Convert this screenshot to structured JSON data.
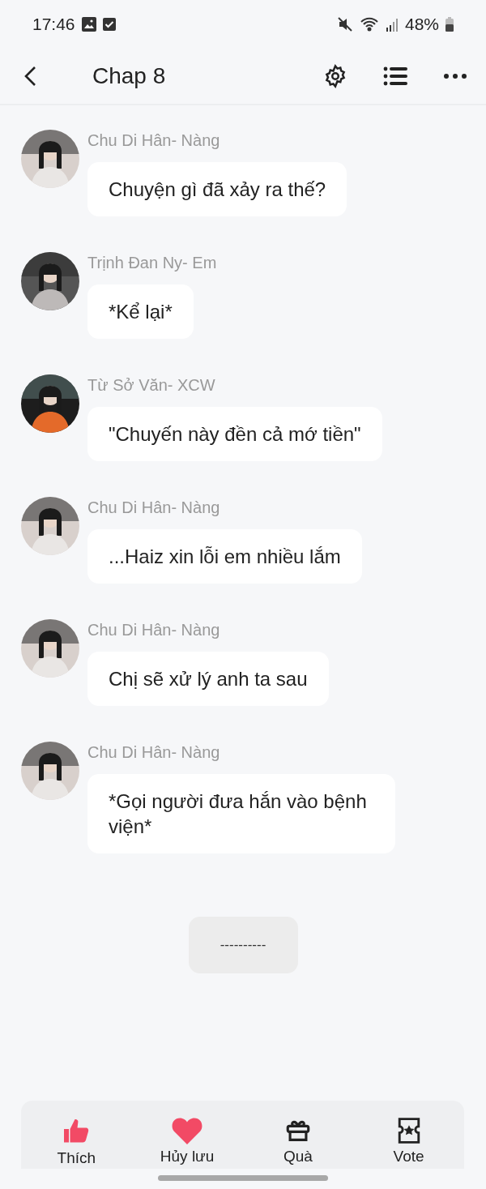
{
  "status_bar": {
    "time": "17:46",
    "battery": "48%"
  },
  "header": {
    "title": "Chap 8"
  },
  "messages": [
    {
      "name": "Chu Di Hân- Nàng",
      "text": "Chuyện gì đã xảy ra thế?"
    },
    {
      "name": "Trịnh Đan Ny- Em",
      "text": "*Kể lại*"
    },
    {
      "name": "Từ Sở Văn- XCW",
      "text": "\"Chuyến này đền cả mớ tiền\""
    },
    {
      "name": "Chu Di Hân- Nàng",
      "text": "...Haiz xin lỗi em nhiều lắm"
    },
    {
      "name": "Chu Di Hân- Nàng",
      "text": "Chị sẽ xử lý anh ta sau"
    },
    {
      "name": "Chu Di Hân- Nàng",
      "text": "*Gọi người đưa hắn vào bệnh viện*"
    }
  ],
  "divider": "----------",
  "actions": [
    {
      "kind": "like",
      "label": "Thích"
    },
    {
      "kind": "heart",
      "label": "Hủy lưu"
    },
    {
      "kind": "gift",
      "label": "Quà"
    },
    {
      "kind": "ticket",
      "label": "Vote"
    }
  ]
}
